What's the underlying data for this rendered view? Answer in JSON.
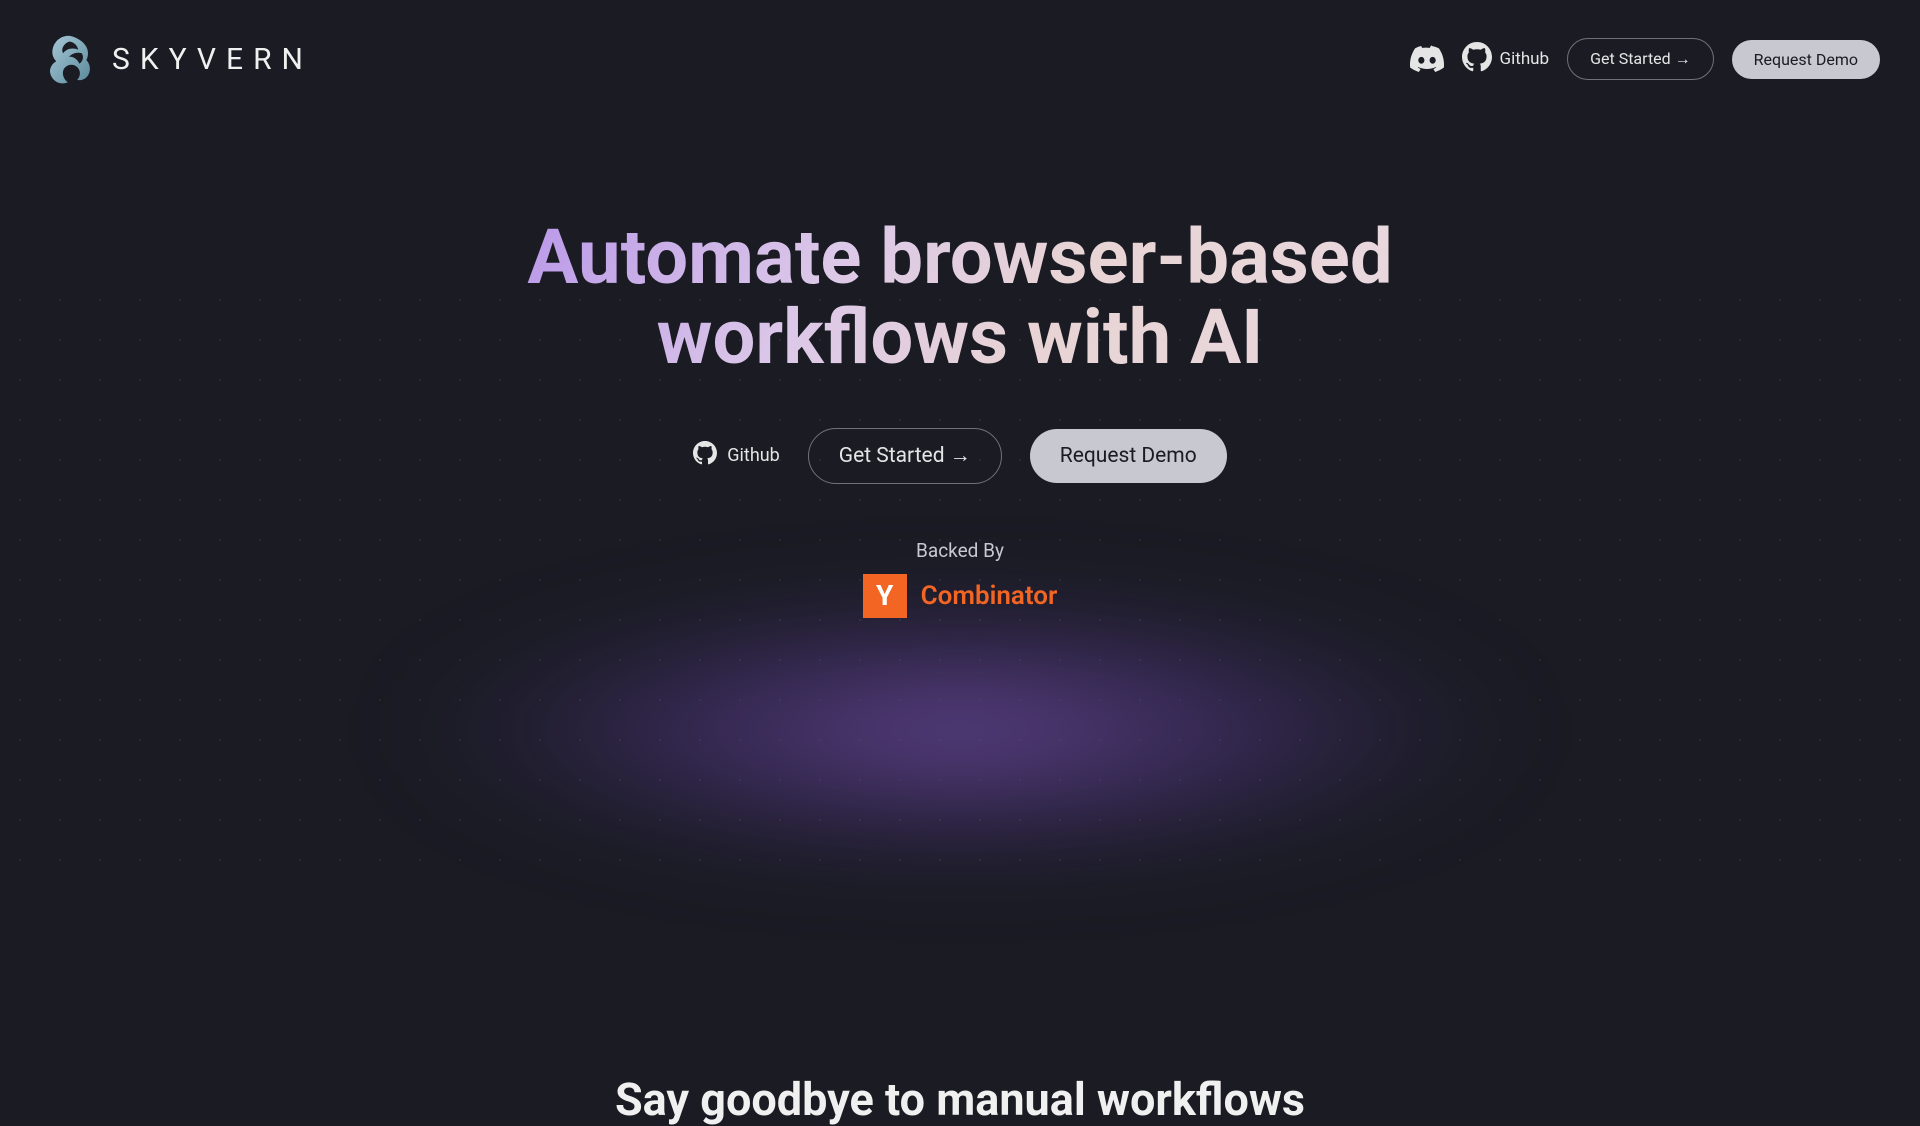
{
  "brand": {
    "name": "SKYVERN"
  },
  "nav": {
    "github_label": "Github",
    "get_started_label": "Get Started →",
    "request_demo_label": "Request Demo"
  },
  "hero": {
    "title": "Automate browser-based workflows with AI",
    "github_label": "Github",
    "get_started_label": "Get Started →",
    "request_demo_label": "Request Demo"
  },
  "backed_by": {
    "label": "Backed By",
    "yc_letter": "Y",
    "yc_name": "Combinator"
  },
  "section": {
    "heading": "Say goodbye to manual workflows"
  }
}
